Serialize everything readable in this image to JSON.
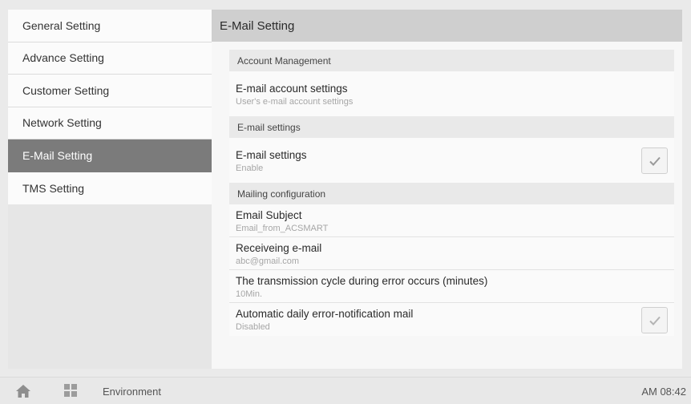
{
  "sidebar": {
    "items": [
      {
        "label": "General Setting"
      },
      {
        "label": "Advance Setting"
      },
      {
        "label": "Customer Setting"
      },
      {
        "label": "Network Setting"
      },
      {
        "label": "E-Mail Setting",
        "active": true
      },
      {
        "label": "TMS Setting"
      }
    ]
  },
  "main": {
    "title": "E-Mail Setting",
    "sections": {
      "account": {
        "header": "Account Management",
        "account_settings": {
          "title": "E-mail account settings",
          "subtitle": "User's e-mail account settings"
        }
      },
      "email": {
        "header": "E-mail settings",
        "email_settings": {
          "title": "E-mail settings",
          "subtitle": "Enable",
          "checked": true
        }
      },
      "mailing": {
        "header": "Mailing configuration",
        "subject": {
          "title": "Email Subject",
          "subtitle": "Email_from_ACSMART"
        },
        "receiving": {
          "title": "Receiveing e-mail",
          "subtitle": "abc@gmail.com"
        },
        "cycle": {
          "title": "The transmission cycle during error occurs (minutes)",
          "subtitle": "10Min."
        },
        "daily": {
          "title": "Automatic daily error-notification mail",
          "subtitle": "Disabled",
          "checked": true
        }
      }
    }
  },
  "bottom_bar": {
    "home_icon": "home-icon",
    "apps_icon": "apps-grid-icon",
    "label": "Environment",
    "time": "AM 08:42"
  },
  "colors": {
    "active_sidebar": "#7b7b7b",
    "header_bg": "#cfcfcf",
    "section_bg": "#e9e9e9"
  }
}
